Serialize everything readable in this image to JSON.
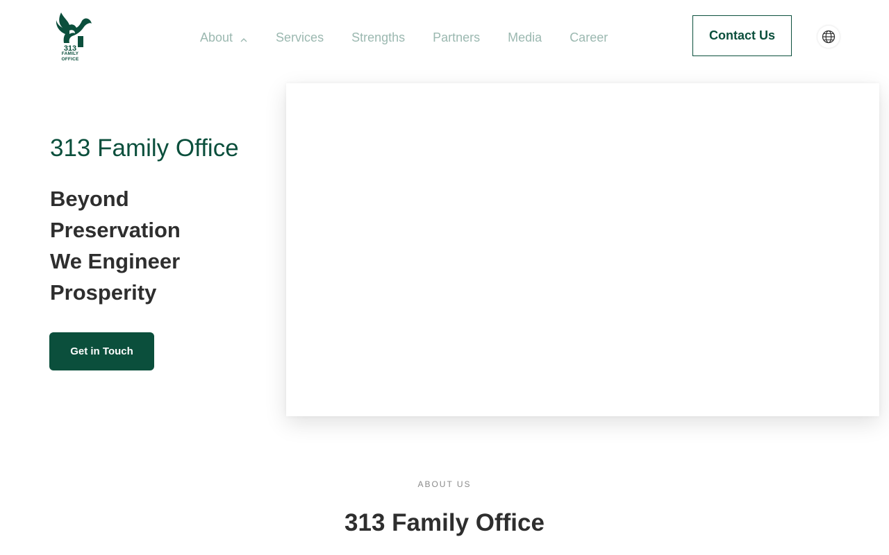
{
  "brand": {
    "logo_number": "313",
    "logo_line1": "FAMILY",
    "logo_line2": "OFFICE",
    "logo_icon": "phoenix-icon",
    "color": "#0b4f3c"
  },
  "nav": {
    "items": [
      {
        "label": "About",
        "has_dropdown": true
      },
      {
        "label": "Services"
      },
      {
        "label": "Strengths"
      },
      {
        "label": "Partners"
      },
      {
        "label": "Media"
      },
      {
        "label": "Career"
      }
    ],
    "contact_label": "Contact Us",
    "language_icon": "globe-icon"
  },
  "hero": {
    "subtitle": "313 Family Office",
    "title_lines": [
      "Beyond",
      "Preservation",
      "We Engineer",
      "Prosperity"
    ],
    "cta_label": "Get in Touch"
  },
  "about": {
    "label": "ABOUT US",
    "title": "313 Family Office"
  }
}
